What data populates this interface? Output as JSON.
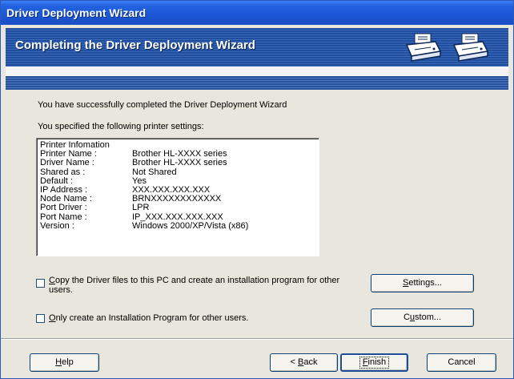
{
  "window": {
    "title": "Driver Deployment Wizard"
  },
  "banner": {
    "title": "Completing the Driver Deployment Wizard",
    "icon": "printer-icon"
  },
  "body": {
    "completed_text": "You have successfully completed the Driver Deployment Wizard",
    "specified_text": "You specified the following printer settings:"
  },
  "printer_info": {
    "heading": "Printer Infomation",
    "rows": [
      {
        "label": "Printer Name :",
        "value": "Brother HL-XXXX series"
      },
      {
        "label": "Driver Name :",
        "value": "Brother HL-XXXX series"
      },
      {
        "label": "Shared as :",
        "value": "Not Shared"
      },
      {
        "label": "Default :",
        "value": "Yes"
      },
      {
        "label": "IP Address :",
        "value": "XXX.XXX.XXX.XXX"
      },
      {
        "label": "Node Name :",
        "value": "BRNXXXXXXXXXXXX"
      },
      {
        "label": "Port Driver :",
        "value": "LPR"
      },
      {
        "label": "Port Name :",
        "value": "IP_XXX.XXX.XXX.XXX"
      },
      {
        "label": "Version :",
        "value": "Windows 2000/XP/Vista (x86)"
      }
    ]
  },
  "options": {
    "copy_files": {
      "mnemonic": "C",
      "label_rest": "opy the Driver files to this PC and create an installation program for other",
      "label_line2": "users.",
      "checked": false
    },
    "only_create": {
      "mnemonic": "O",
      "label_rest": "nly create an Installation Program for other users.",
      "checked": false
    }
  },
  "buttons": {
    "settings": {
      "mnemonic": "S",
      "rest": "ettings..."
    },
    "custom": {
      "pre": "C",
      "mnemonic": "u",
      "rest": "stom..."
    },
    "help": {
      "mnemonic": "H",
      "rest": "elp"
    },
    "back": {
      "pre": "< ",
      "mnemonic": "B",
      "rest": "ack"
    },
    "finish": {
      "mnemonic": "F",
      "rest": "inish"
    },
    "cancel": {
      "label": "Cancel"
    }
  }
}
